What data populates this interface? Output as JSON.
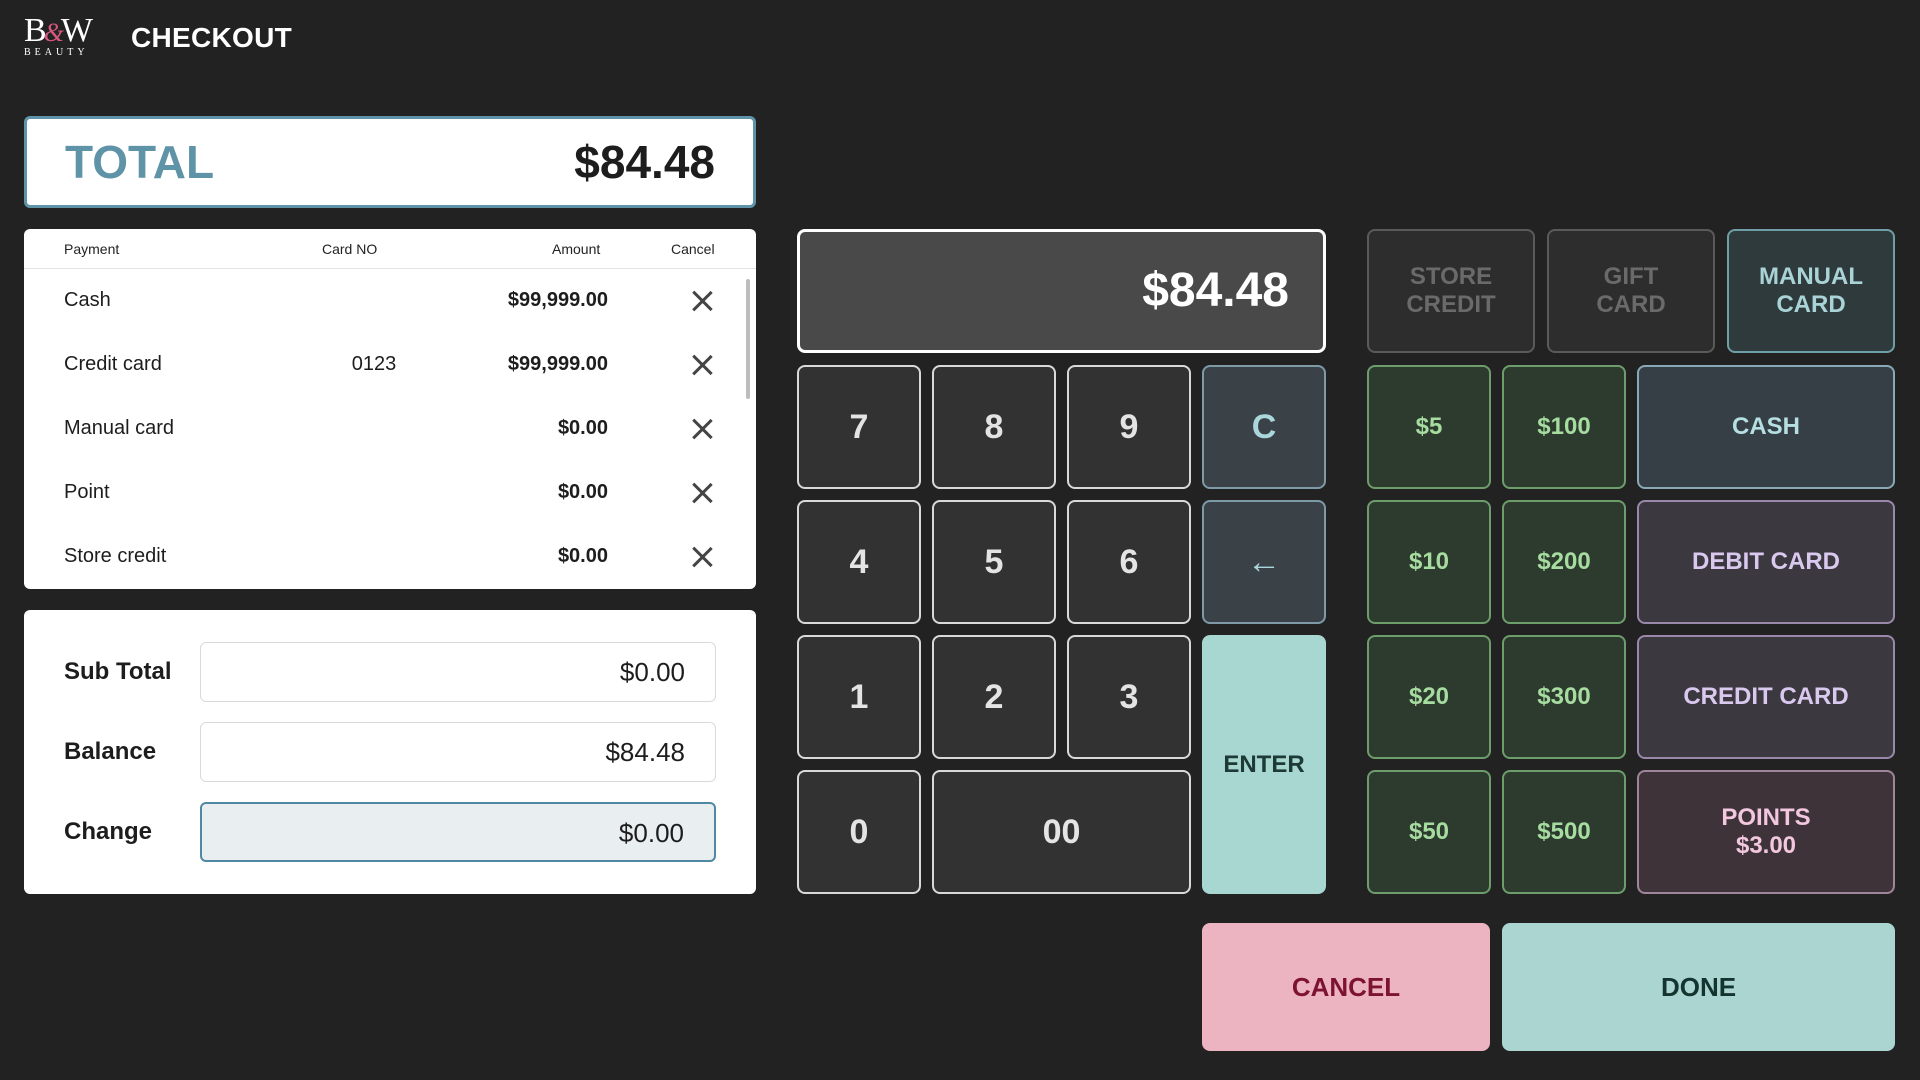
{
  "header": {
    "logo_main": "BW",
    "logo_amp": "&",
    "logo_sub": "BEAUTY",
    "title": "CHECKOUT"
  },
  "total": {
    "label": "TOTAL",
    "value": "$84.48"
  },
  "payments": {
    "columns": [
      "Payment",
      "Card NO",
      "Amount",
      "Cancel"
    ],
    "rows": [
      {
        "payment": "Cash",
        "card_no": "",
        "amount": "$99,999.00"
      },
      {
        "payment": "Credit card",
        "card_no": "0123",
        "amount": "$99,999.00"
      },
      {
        "payment": "Manual card",
        "card_no": "",
        "amount": "$0.00"
      },
      {
        "payment": "Point",
        "card_no": "",
        "amount": "$0.00"
      },
      {
        "payment": "Store credit",
        "card_no": "",
        "amount": "$0.00"
      }
    ]
  },
  "summary": {
    "subtotal_label": "Sub Total",
    "subtotal_value": "$0.00",
    "balance_label": "Balance",
    "balance_value": "$84.48",
    "change_label": "Change",
    "change_value": "$0.00"
  },
  "keypad": {
    "display": "$84.48",
    "k7": "7",
    "k8": "8",
    "k9": "9",
    "clear": "C",
    "k4": "4",
    "k5": "5",
    "k6": "6",
    "backspace": "←",
    "k1": "1",
    "k2": "2",
    "k3": "3",
    "enter": "ENTER",
    "k0": "0",
    "k00": "00"
  },
  "tenders": {
    "store_credit_1": "STORE",
    "store_credit_2": "CREDIT",
    "gift_card_1": "GIFT",
    "gift_card_2": "CARD",
    "manual_card_1": "MANUAL",
    "manual_card_2": "CARD",
    "m5": "$5",
    "m100": "$100",
    "cash": "CASH",
    "m10": "$10",
    "m200": "$200",
    "debit": "DEBIT CARD",
    "m20": "$20",
    "m300": "$300",
    "credit": "CREDIT CARD",
    "m50": "$50",
    "m500": "$500",
    "points_1": "POINTS",
    "points_2": "$3.00"
  },
  "actions": {
    "cancel": "CANCEL",
    "done": "DONE"
  },
  "colors": {
    "background": "#232223",
    "accent_teal": "#5f93a7",
    "money_green": "#a6dca0",
    "cancel_pink": "#ecb4c0",
    "done_teal": "#aad5d1"
  }
}
